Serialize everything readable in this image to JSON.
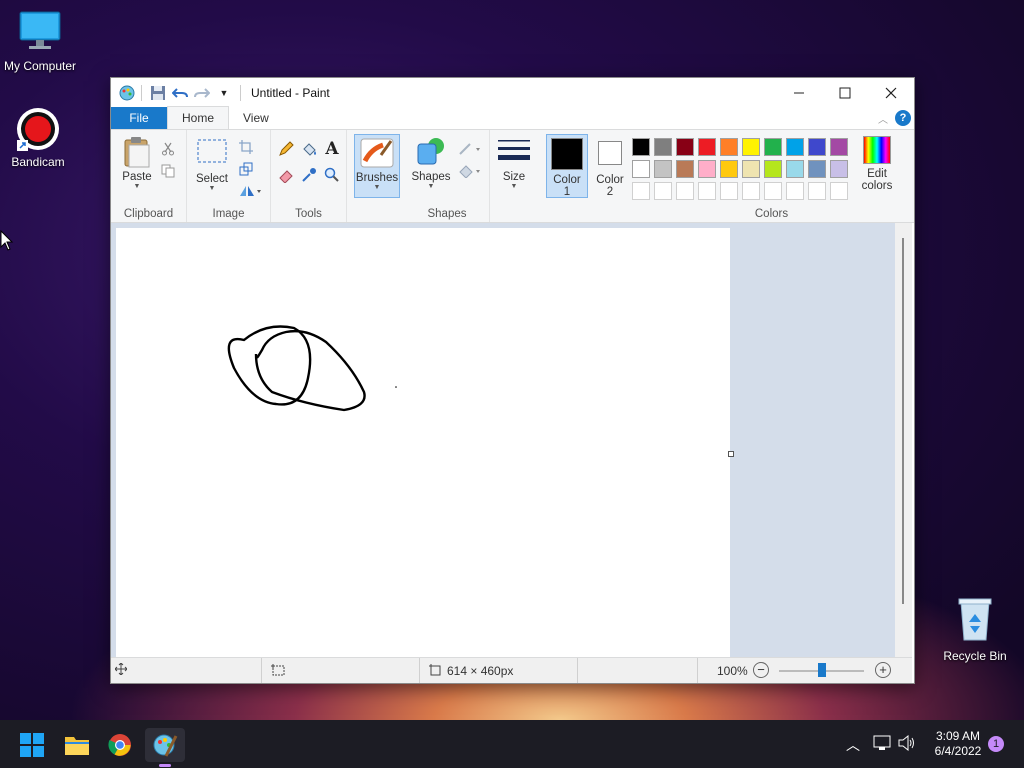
{
  "desktop": {
    "icons": [
      {
        "label": "My Computer"
      },
      {
        "label": "Bandicam"
      },
      {
        "label": "Recycle Bin"
      }
    ]
  },
  "window": {
    "title": "Untitled - Paint",
    "tabs": [
      "File",
      "Home",
      "View"
    ]
  },
  "ribbon": {
    "clipboard": {
      "paste": "Paste",
      "label": "Clipboard"
    },
    "image": {
      "select": "Select",
      "label": "Image"
    },
    "tools": {
      "label": "Tools"
    },
    "brushes": {
      "label": "Brushes"
    },
    "shapes": {
      "button": "Shapes",
      "label": "Shapes"
    },
    "size": {
      "label": "Size"
    },
    "color1": {
      "line1": "Color",
      "line2": "1",
      "value": "#000000"
    },
    "color2": {
      "line1": "Color",
      "line2": "2",
      "value": "#ffffff"
    },
    "colors": {
      "label": "Colors",
      "edit_line1": "Edit",
      "edit_line2": "colors",
      "row1": [
        "#000000",
        "#7f7f7f",
        "#880015",
        "#ed1c24",
        "#ff7f27",
        "#fff200",
        "#22b14c",
        "#00a2e8",
        "#3f48cc",
        "#a349a4"
      ],
      "row2": [
        "#ffffff",
        "#c3c3c3",
        "#b97a57",
        "#ffaec9",
        "#ffc90e",
        "#efe4b0",
        "#b5e61d",
        "#99d9ea",
        "#7092be",
        "#c8bfe7"
      ]
    }
  },
  "status": {
    "canvas_size": "614 × 460px",
    "zoom": "100%",
    "zoom_level": 0.5
  },
  "taskbar": {
    "time": "3:09 AM",
    "date": "6/4/2022",
    "notification_count": "1"
  }
}
